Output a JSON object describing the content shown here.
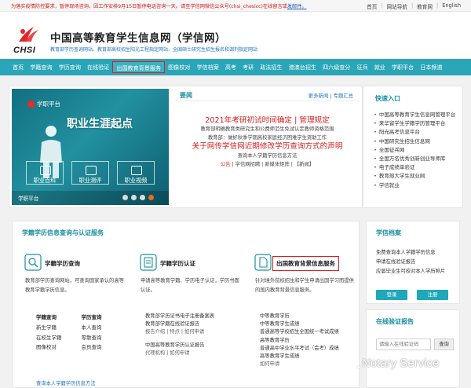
{
  "topbar": {
    "notice_text": "为落实疫情防控要求，暂停现场咨询。因工作安排9月15日暂停电话咨询一天。请至学信网微信公众号(chsi_chesicc)在线留言或",
    "notice_link": "发邮件。",
    "links": [
      "首页",
      "网站导航",
      "教育网",
      "English"
    ]
  },
  "header": {
    "logo_text": "CHSI",
    "site_name": "中国高等教育学生信息网（学信网）",
    "tagline": "教育部学历查询网站、教育部高校招生阳光工程指定网站、全国硕士研究生招生报名和调剂指定网站"
  },
  "nav": {
    "items": [
      "首页",
      "学籍查询",
      "学历查询",
      "在线验证",
      "出国教育背景服务",
      "图像校对",
      "学信档案",
      "高考",
      "考研",
      "政法招生",
      "港澳台招生",
      "四六级查分",
      "征兵",
      "就业",
      "学职平台",
      "日本频道"
    ],
    "highlighted_index": 4
  },
  "banner": {
    "brand": "学职平台",
    "headline": "职业生涯起点",
    "buttons": [
      "职业百科",
      "职业测评",
      "职业视频"
    ],
    "footer_label": "学职平台",
    "dots": 4,
    "active_dot": 3
  },
  "news": {
    "title": "要闻",
    "more": "更多新闻",
    "topics": "专题汇总",
    "headline1": "2021年考研初试时间确定 | 管理规定",
    "line1": "教育部明确教育类研究生和公费师范生免试认定教师资格范围",
    "line2": "教育部：做好秋季学期高校家庭经济困难学生资助工作",
    "headline2": "关于网传学信网近期修改学历查询方式的声明",
    "line3": "查询本人学籍学历信息方法",
    "line4_a": "公告",
    "line4_b": "学信网招聘 | 新媒体矩阵 | 【新闻】"
  },
  "quick": {
    "title": "快速入口",
    "items": [
      "中国高等教育学生信息网管理平台",
      "来华留学生学籍学历管理平台",
      "阳光高考信息平台",
      "中国研究生招生信息网",
      "全国征兵网",
      "全国万名优秀创新创业导师库",
      "电子成绩单验证",
      "教育部大学生就业网",
      "学信就业"
    ]
  },
  "verify": {
    "title": "学籍学历信息查询与认证服务",
    "col1": {
      "title": "学籍学历查询",
      "desc": "教育部学历查询网站，可查询国家承认的高等教育学籍学历信息。",
      "grid": [
        "学籍查询",
        "学历查询",
        "新生学籍",
        "本人查询",
        "在校生学籍",
        "零散查询",
        "图像校对",
        "会员查询"
      ],
      "link": "查询本人学籍学历信息方法"
    },
    "col2": {
      "title": "学籍学历认证",
      "desc": "申请高等教育学籍、学历电子认证，学历书面认证。",
      "list": [
        {
          "text": "教育部学历证书电子注册备案表",
          "sub": false
        },
        {
          "text": "教育部学籍在线验证报告",
          "sub": false
        },
        {
          "text": "报告介绍  |  特点  |  如何申请",
          "sub": true
        },
        {
          "text": "",
          "sub": false
        },
        {
          "text": "中国高等教育学历认证报告",
          "sub": false
        },
        {
          "text": "代理机构  |  如何申请",
          "sub": true
        }
      ]
    },
    "col3": {
      "title": "出国教育背景信息服务",
      "desc": "针对境外院校招生和学生申请出国学习而提供的国内教育背景信息服务。",
      "list": [
        {
          "text": "中等教育学历",
          "sub": false
        },
        {
          "text": "中等教育学生成绩",
          "sub": false
        },
        {
          "text": "普通高等学校招生全国统一考试成绩",
          "sub": false
        },
        {
          "text": "高等教育学历",
          "sub": false
        },
        {
          "text": "普通高中学业水平考试（会考）成绩",
          "sub": false
        },
        {
          "text": "高等教育学生成绩",
          "sub": false
        },
        {
          "text": "如何申请",
          "sub": true
        }
      ]
    }
  },
  "archive": {
    "title": "学信档案",
    "lines": [
      "免费查询本人学籍学历信息",
      "申请在线验证报告",
      "应届毕业生可校对本人学历照片"
    ],
    "login": "登录",
    "register": "注册"
  },
  "online": {
    "title": "在线验证报告",
    "placeholder": "请输入在线验证码",
    "search": "查询"
  },
  "watermark": "Notary Service",
  "colors": {
    "nav_bg": "#2aa6b8",
    "accent": "#1a8fa2",
    "headline_red": "#d61b1b",
    "highlight_border": "#e01d1d"
  }
}
